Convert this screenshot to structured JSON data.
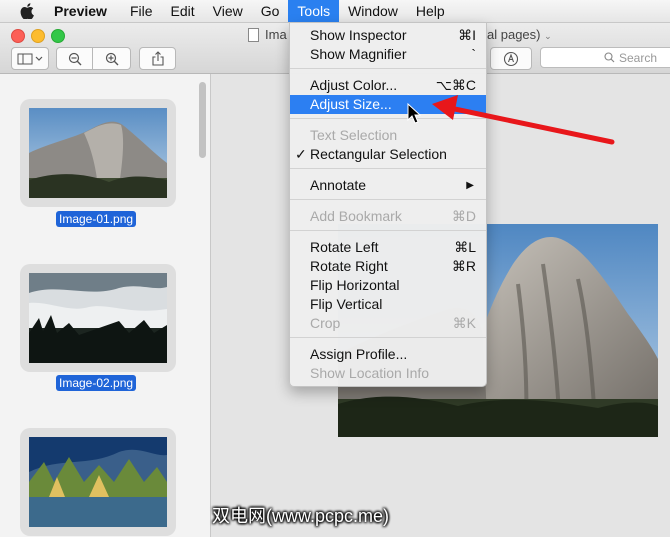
{
  "menubar": {
    "apple_icon": "apple-icon",
    "items": [
      "Preview",
      "File",
      "Edit",
      "View",
      "Go",
      "Tools",
      "Window",
      "Help"
    ],
    "active": "Tools"
  },
  "window": {
    "title_start": "Ima",
    "title_end": "al pages)",
    "search_placeholder": "Search"
  },
  "sidebar": {
    "thumbnails": [
      {
        "label": "Image-01.png"
      },
      {
        "label": "Image-02.png"
      }
    ]
  },
  "tools_menu": {
    "items": [
      {
        "label": "Show Inspector",
        "shortcut": "⌘I"
      },
      {
        "label": "Show Magnifier",
        "shortcut": "`"
      },
      {
        "label": "Adjust Color...",
        "shortcut": "⌥⌘C"
      },
      {
        "label": "Adjust Size...",
        "shortcut": "",
        "highlighted": true
      },
      {
        "label": "Text Selection",
        "shortcut": "",
        "disabled": true
      },
      {
        "label": "Rectangular Selection",
        "shortcut": "",
        "checked": true
      },
      {
        "label": "Annotate",
        "shortcut": "",
        "submenu": true
      },
      {
        "label": "Add Bookmark",
        "shortcut": "⌘D",
        "disabled": true
      },
      {
        "label": "Rotate Left",
        "shortcut": "⌘L"
      },
      {
        "label": "Rotate Right",
        "shortcut": "⌘R"
      },
      {
        "label": "Flip Horizontal",
        "shortcut": ""
      },
      {
        "label": "Flip Vertical",
        "shortcut": ""
      },
      {
        "label": "Crop",
        "shortcut": "⌘K",
        "disabled": true
      },
      {
        "label": "Assign Profile...",
        "shortcut": ""
      },
      {
        "label": "Show Location Info",
        "shortcut": "",
        "disabled": true
      }
    ]
  },
  "checkmark": "✓",
  "submenu_arrow": "▶",
  "watermark": "双电网(www.pcpc.me)",
  "colors": {
    "highlight": "#2c7ff2",
    "arrow": "#e8171b",
    "label_bg": "#1f64d8"
  }
}
